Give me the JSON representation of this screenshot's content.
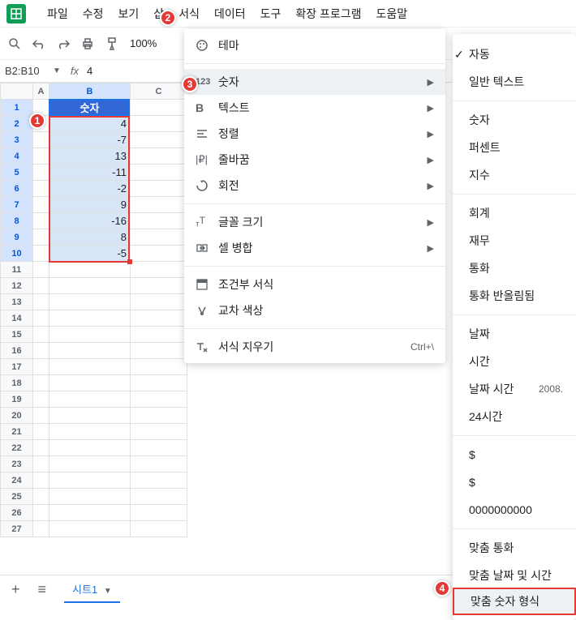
{
  "menubar": [
    "파일",
    "수정",
    "보기",
    "삽",
    "서식",
    "데이터",
    "도구",
    "확장 프로그램",
    "도움말"
  ],
  "toolbar": {
    "zoom": "100%"
  },
  "formula": {
    "nameBox": "B2:B10",
    "fx": "fx",
    "value": "4"
  },
  "columns": [
    "A",
    "B",
    "C"
  ],
  "rows": [
    "1",
    "2",
    "3",
    "4",
    "5",
    "6",
    "7",
    "8",
    "9",
    "10",
    "11",
    "12",
    "13",
    "14",
    "15",
    "16",
    "17",
    "18",
    "19",
    "20",
    "21",
    "22",
    "23",
    "24",
    "25",
    "26",
    "27"
  ],
  "b1": "숫자",
  "bvals": [
    "4",
    "-7",
    "13",
    "-11",
    "-2",
    "9",
    "-16",
    "8",
    "-5"
  ],
  "dropdown": [
    {
      "icon": "theme",
      "label": "테마",
      "arrow": false
    },
    {
      "sep": true
    },
    {
      "icon": "123",
      "label": "숫자",
      "arrow": true,
      "hover": true
    },
    {
      "icon": "B",
      "label": "텍스트",
      "arrow": true
    },
    {
      "icon": "align",
      "label": "정렬",
      "arrow": true
    },
    {
      "icon": "wrap",
      "label": "줄바꿈",
      "arrow": true
    },
    {
      "icon": "rotate",
      "label": "회전",
      "arrow": true
    },
    {
      "sep": true
    },
    {
      "icon": "tT",
      "label": "글꼴 크기",
      "arrow": true
    },
    {
      "icon": "merge",
      "label": "셀 병합",
      "arrow": true
    },
    {
      "sep": true
    },
    {
      "icon": "cond",
      "label": "조건부 서식"
    },
    {
      "icon": "alt",
      "label": "교차 색상"
    },
    {
      "sep": true
    },
    {
      "icon": "clear",
      "label": "서식 지우기",
      "shortcut": "Ctrl+\\"
    }
  ],
  "submenu": [
    {
      "label": "자동",
      "check": true
    },
    {
      "label": "일반 텍스트"
    },
    {
      "sep": true
    },
    {
      "label": "숫자"
    },
    {
      "label": "퍼센트"
    },
    {
      "label": "지수"
    },
    {
      "sep": true
    },
    {
      "label": "회계"
    },
    {
      "label": "재무"
    },
    {
      "label": "통화"
    },
    {
      "label": "통화 반올림됨"
    },
    {
      "sep": true
    },
    {
      "label": "날짜"
    },
    {
      "label": "시간"
    },
    {
      "label": "날짜 시간",
      "right": "2008."
    },
    {
      "label": "24시간"
    },
    {
      "sep": true
    },
    {
      "label": "$"
    },
    {
      "label": "$"
    },
    {
      "label": "0000000000"
    },
    {
      "sep": true
    },
    {
      "label": "맞춤 통화"
    },
    {
      "label": "맞춤 날짜 및 시간"
    },
    {
      "label": "맞춤 숫자 형식",
      "hl": true
    }
  ],
  "callouts": {
    "c1": "1",
    "c2": "2",
    "c3": "3",
    "c4": "4"
  },
  "tabs": {
    "sheet": "시트1"
  }
}
